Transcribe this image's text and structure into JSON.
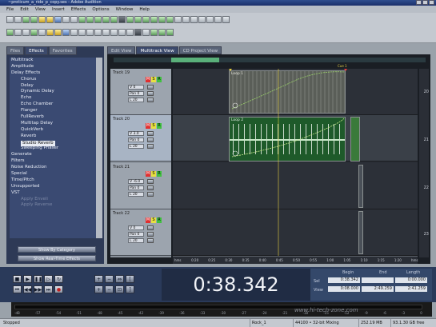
{
  "window": {
    "title": "~proticum_a_ride_p_copy.ses - Adobe Audition"
  },
  "menu": [
    "File",
    "Edit",
    "View",
    "Insert",
    "Effects",
    "Options",
    "Window",
    "Help"
  ],
  "left_panel": {
    "tabs": [
      "Files",
      "Effects",
      "Favorites"
    ],
    "active_tab": "Effects",
    "tree": [
      {
        "label": "Multitrack",
        "depth": 0
      },
      {
        "label": "Amplitude",
        "depth": 0
      },
      {
        "label": "Delay Effects",
        "depth": 0
      },
      {
        "label": "Chorus",
        "depth": 1
      },
      {
        "label": "Delay",
        "depth": 1
      },
      {
        "label": "Dynamic Delay",
        "depth": 1
      },
      {
        "label": "Echo",
        "depth": 1
      },
      {
        "label": "Echo Chamber",
        "depth": 1
      },
      {
        "label": "Flanger",
        "depth": 1
      },
      {
        "label": "FullReverb",
        "depth": 1
      },
      {
        "label": "Multitap Delay",
        "depth": 1
      },
      {
        "label": "QuickVerb",
        "depth": 1
      },
      {
        "label": "Reverb",
        "depth": 1
      },
      {
        "label": "Studio Reverb",
        "depth": 1,
        "selected": true
      },
      {
        "label": "Sweeping Phaser",
        "depth": 1
      },
      {
        "label": "Generate",
        "depth": 0
      },
      {
        "label": "Filters",
        "depth": 0
      },
      {
        "label": "Noise Reduction",
        "depth": 0
      },
      {
        "label": "Special",
        "depth": 0
      },
      {
        "label": "Time/Pitch",
        "depth": 0
      },
      {
        "label": "Unsupported",
        "depth": 0
      },
      {
        "label": "VST",
        "depth": 0
      },
      {
        "label": "Apply Enveli",
        "depth": 1,
        "dim": true
      },
      {
        "label": "Apply Reverse",
        "depth": 1,
        "dim": true
      }
    ],
    "buttons": [
      "Show By Category",
      "Show Real-Time Effects"
    ]
  },
  "main_tabs": [
    "Edit View",
    "Multitrack View",
    "CD Project View"
  ],
  "active_main_tab": "Multitrack View",
  "tracks": [
    {
      "name": "Track 19",
      "volume": "V 0",
      "pan": "Pan 0",
      "out": "L 20",
      "lane_number": "20"
    },
    {
      "name": "Track 20",
      "volume": "V 3.0",
      "pan": "Pan 0",
      "out": "L 20",
      "lane_number": "21"
    },
    {
      "name": "Track 21",
      "volume": "V -6.0",
      "pan": "Pan 0",
      "out": "L 20",
      "lane_number": "22"
    },
    {
      "name": "Track 22",
      "volume": "V 0",
      "pan": "Pan 0",
      "out": "L 20",
      "lane_number": "23"
    }
  ],
  "track_badges": {
    "mute": "M",
    "solo": "S",
    "record": "R"
  },
  "clips": {
    "clip1_label": "Loop 1",
    "clip2_label": "Loop 2",
    "marker_label": "Cue 1"
  },
  "ruler_ticks": [
    "hms",
    "0:20",
    "0:25",
    "0:30",
    "0:35",
    "0:40",
    "0:45",
    "0:50",
    "0:55",
    "1:00",
    "1:05",
    "1:10",
    "1:15",
    "1:20",
    "hms"
  ],
  "transport": {
    "time": "0:38.342",
    "buttons": [
      "stop",
      "play",
      "pause",
      "play-looped",
      "loop",
      "go-to-start",
      "rewind",
      "fast-forward",
      "go-to-end",
      "record"
    ],
    "zoom_buttons": [
      "zoom-in-h",
      "zoom-out-h",
      "zoom-full",
      "zoom-in-left",
      "zoom-in-right",
      "zoom-in-v",
      "zoom-out-v",
      "zoom-sel"
    ]
  },
  "selection_view": {
    "headers": [
      "Begin",
      "End",
      "Length"
    ],
    "rows": [
      {
        "label": "Sel",
        "begin": "0:38.342",
        "end": "",
        "length": "0:00.000"
      },
      {
        "label": "View",
        "begin": "0:08.000",
        "end": "2:49.259",
        "length": "2:41.259"
      }
    ]
  },
  "meter_scale": [
    "-dB",
    "-57",
    "-54",
    "-51",
    "-48",
    "-45",
    "-42",
    "-39",
    "-36",
    "-33",
    "-30",
    "-27",
    "-24",
    "-21",
    "-18",
    "-15",
    "-12",
    "-9",
    "-6",
    "-3",
    "0"
  ],
  "status": {
    "left": "Stopped",
    "track": "Rock_1",
    "format": "44100 • 32-bit Mixing",
    "size": "252.19 MB",
    "free": "93.1.30 GB free"
  },
  "watermark": "www.hi-tech-zone.com"
}
